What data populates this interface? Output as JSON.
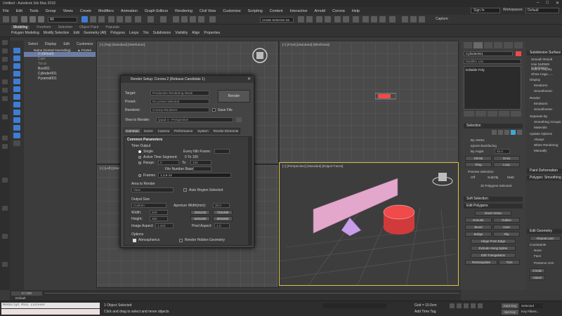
{
  "window": {
    "title": "Untitled - Autodesk 3ds Max 2018"
  },
  "menu": [
    "File",
    "Edit",
    "Tools",
    "Group",
    "Views",
    "Create",
    "Modifiers",
    "Animation",
    "Graph Editors",
    "Rendering",
    "Civil View",
    "Customize",
    "Scripting",
    "Content",
    "Interactive",
    "Arnold",
    "Corona",
    "Help"
  ],
  "account": {
    "sign_in": "Sign In",
    "workspaces_label": "Workspaces:",
    "workspace": "Default"
  },
  "toolbar": {
    "view_dropdown": "All",
    "selection_set": "Create Selection Se",
    "capture": "Capture"
  },
  "ribbon": {
    "tabs": [
      "Modeling",
      "Freeform",
      "Selection",
      "Object Paint",
      "Populate"
    ],
    "active_tab": "Modeling",
    "subtabs": [
      "Polygon Modeling",
      "Modify Selection",
      "Edit",
      "Geometry (All)",
      "Polygons",
      "Loops",
      "Tris",
      "Subdivision",
      "Visibility",
      "Align",
      "Properties"
    ]
  },
  "explorer": {
    "tabs": [
      "Select",
      "Display",
      "Edit",
      "Customize"
    ],
    "header": "Name (Sorted Ascending)",
    "frozen": "▲ Frozen",
    "rows": [
      {
        "label": "0 (default)",
        "hl": true
      },
      {
        "label": "Cam",
        "hl": false,
        "dim": true
      },
      {
        "label": "Torus",
        "hl": false,
        "dim": true
      },
      {
        "label": "Box001",
        "hl": false
      },
      {
        "label": "Cylinder001",
        "hl": false
      },
      {
        "label": "Pyramid001",
        "hl": false
      }
    ]
  },
  "viewports": {
    "top": "[+] [Top] [Standard] [Wireframe]",
    "front": "[+] [Front] [Standard] [Wireframe]",
    "left": "[+] [Left] [Standard] [Wireframe]",
    "perspective": "[+] [Perspective] [Standard] [Edged Faces]"
  },
  "render": {
    "title": "Render Setup: Corona 2 (Release Candidate 1)",
    "target_label": "Target:",
    "target_value": "Production Rendering Mode",
    "preset_label": "Preset:",
    "preset_value": "No preset selected",
    "renderer_label": "Renderer:",
    "renderer_value": "Corona Renderer",
    "savefile_label": "Save File",
    "view_label": "View to Render:",
    "view_value": "Quad 4 - Perspective",
    "render_button": "Render",
    "tabs": [
      "Common",
      "Scene",
      "Camera",
      "Performance",
      "System",
      "Render Elements"
    ],
    "section_title": "Common Parameters",
    "time_output": "Time Output",
    "single": "Single",
    "every_nth": "Every Nth Frame:",
    "active_segment": "Active Time Segment:",
    "active_range": "0 To 100",
    "range": "Range:",
    "range_from": "0",
    "range_to_label": "To",
    "range_to": "100",
    "file_number_base": "File Number Base:",
    "frames": "Frames",
    "frames_value": "1,3,5-12",
    "area_to_render": "Area to Render",
    "area_value": "View",
    "auto_region": "Auto Region Selected",
    "output_size": "Output Size",
    "output_preset": "Custom",
    "aperture_label": "Aperture Width(mm):",
    "aperture_value": "36.0",
    "width_label": "Width:",
    "width_value": "640",
    "height_label": "Height:",
    "height_value": "480",
    "image_aspect_label": "Image Aspect:",
    "image_aspect_value": "1.333",
    "pixel_aspect_label": "Pixel Aspect:",
    "pixel_aspect_value": "1.0",
    "res_buttons": [
      "320x240",
      "720x486",
      "640x480",
      "800x600"
    ],
    "options": "Options",
    "atmospherics": "Atmospherics",
    "render_hidden": "Render Hidden Geometry"
  },
  "command_panel": {
    "object_name": "Cylinder001",
    "modifier_list": "Modifier List",
    "stack_item": "Editable Poly",
    "selection": "Selection",
    "by_vertex": "By Vertex",
    "ignore_backfacing": "Ignore Backfacing",
    "by_angle": "By Angle:",
    "by_angle_value": "45.0",
    "shrink": "Shrink",
    "grow": "Grow",
    "ring": "Ring",
    "loop": "Loop",
    "preview_selection": "Preview Selection",
    "off": "Off",
    "subobj": "SubObj",
    "multi": "Multi",
    "polygons_selected": "32 Polygons Selected",
    "soft_selection": "Soft Selection",
    "edit_polygons": "Edit Polygons",
    "insert_vertex": "Insert Vertex",
    "extrude": "Extrude",
    "outline": "Outline",
    "bevel": "Bevel",
    "inset": "Inset",
    "bridge": "Bridge",
    "flip": "Flip",
    "hinge_from_edge": "Hinge From Edge",
    "extrude_along_spline": "Extrude Along Spline",
    "edit_triangulation": "Edit Triangulation",
    "retriangulate": "Retriangulate",
    "turn": "Turn"
  },
  "side_panel": {
    "subdivision_surface": "Subdivision Surface",
    "smooth_result": "Smooth Result",
    "use_nurms": "Use NURMS Subdivision",
    "isoline_display": "Isoline Display",
    "show_cage": "Show Cage......",
    "display": "Display",
    "iterations": "Iterations:",
    "smoothness": "Smoothness:",
    "render": "Render",
    "separate_by": "Separate By",
    "smoothing_groups": "Smoothing Groups",
    "materials": "Materials",
    "update_options": "Update Options",
    "always": "Always",
    "when_rendering": "When Rendering",
    "manually": "Manually",
    "paint_deformation": "Paint Deformation",
    "polygon_smoothing": "Polygon: Smoothing",
    "edit_geometry": "Edit Geometry",
    "repeat_last": "Repeat Last",
    "constraints": "Constraints",
    "none": "None",
    "face": "Face",
    "preserve_uvs": "Preserve UVs",
    "create": "Create",
    "attach": "Attach"
  },
  "timeline": {
    "frame": "0 / 100",
    "layer": "Default"
  },
  "status": {
    "maxscript": "MAXScript Mini Listener",
    "selected": "1 Object Selected",
    "hint": "Click and drag to select and move objects",
    "grid": "Grid = 10.0cm",
    "add_time_tag": "Add Time Tag",
    "auto_key": "Auto Key",
    "selected_dropdown": "Selected",
    "set_key": "Set Key",
    "key_filters": "Key Filters..."
  },
  "colors": {
    "accent_blue": "#3f7dd3",
    "viewport_border": "#d8c148",
    "plane_pink": "#e3a7cc",
    "cylinder_red": "#f04a4a",
    "pyramid_purple": "#c89ee8"
  }
}
